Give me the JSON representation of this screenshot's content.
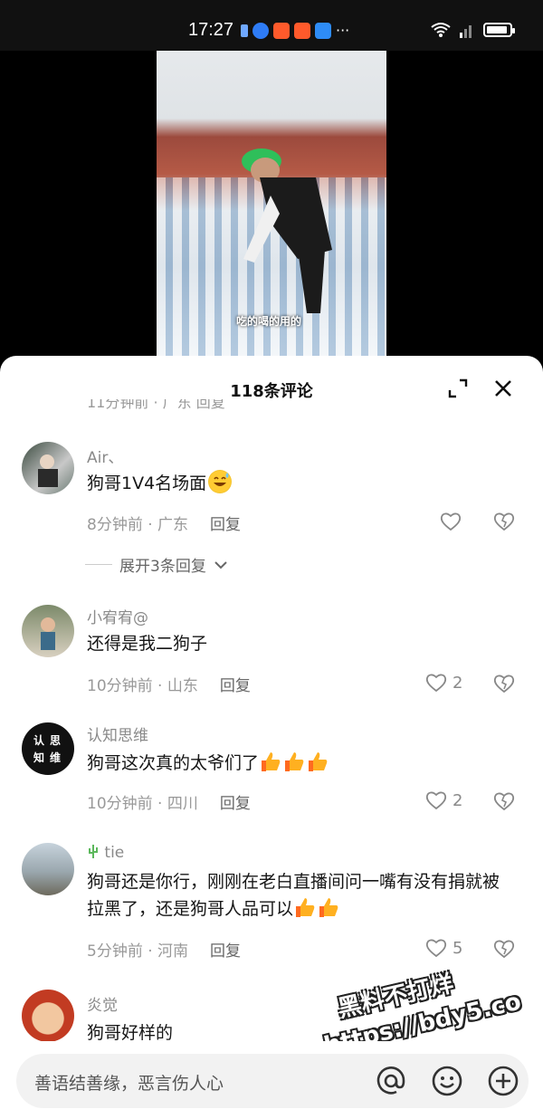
{
  "status_bar": {
    "time": "17:27",
    "more": "···"
  },
  "video": {
    "subtitle": "吃的喝的用的"
  },
  "comments_sheet": {
    "title": "118条评论",
    "partial_row": "11分钟前 · 广东     回复",
    "comments": [
      {
        "username": "Air、",
        "text": "狗哥1V4名场面",
        "time": "8分钟前 · 广东",
        "reply": "回复",
        "likes": "",
        "expand": "展开3条回复"
      },
      {
        "username": "小宥宥@",
        "text": "还得是我二狗子",
        "time": "10分钟前 · 山东",
        "reply": "回复",
        "likes": "2"
      },
      {
        "username": "认知思维",
        "text": "狗哥这次真的太爷们了",
        "time": "10分钟前 · 四川",
        "reply": "回复",
        "likes": "2",
        "avatar_text": [
          "认",
          "思",
          "知",
          "维"
        ]
      },
      {
        "username": "tie",
        "text": "狗哥还是你行，刚刚在老白直播间问一嘴有没有捐就被拉黑了，还是狗哥人品可以",
        "time": "5分钟前 · 河南",
        "reply": "回复",
        "likes": "5"
      },
      {
        "username": "炎觉",
        "text": "狗哥好样的"
      }
    ]
  },
  "input_bar": {
    "placeholder": "善语结善缘，恶言伤人心"
  },
  "watermark": {
    "line1": "黑料不打烊",
    "line2": "https://bdy5.co"
  },
  "colors": {
    "accent_thumb": "#ff9a1f",
    "text_main": "#161616",
    "text_meta": "#999999"
  }
}
